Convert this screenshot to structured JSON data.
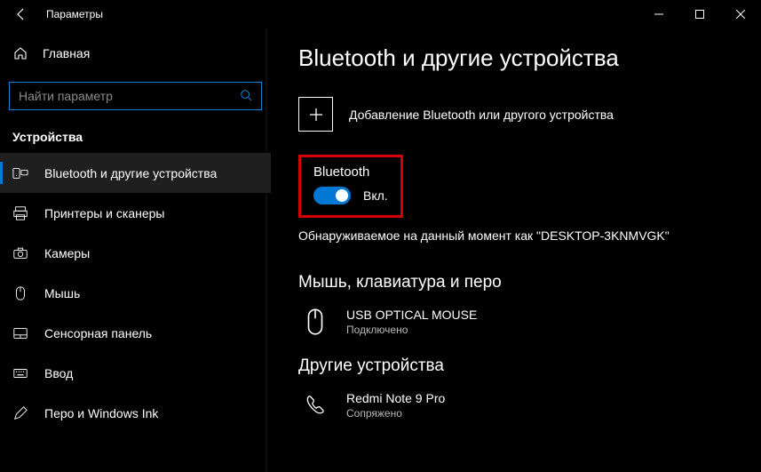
{
  "titlebar": {
    "title": "Параметры"
  },
  "sidebar": {
    "home_label": "Главная",
    "search_placeholder": "Найти параметр",
    "section_label": "Устройства",
    "items": [
      {
        "label": "Bluetooth и другие устройства",
        "icon": "bluetooth-devices-icon",
        "selected": true
      },
      {
        "label": "Принтеры и сканеры",
        "icon": "printer-icon",
        "selected": false
      },
      {
        "label": "Камеры",
        "icon": "camera-icon",
        "selected": false
      },
      {
        "label": "Мышь",
        "icon": "mouse-icon",
        "selected": false
      },
      {
        "label": "Сенсорная панель",
        "icon": "touchpad-icon",
        "selected": false
      },
      {
        "label": "Ввод",
        "icon": "keyboard-icon",
        "selected": false
      },
      {
        "label": "Перо и Windows Ink",
        "icon": "pen-icon",
        "selected": false
      }
    ]
  },
  "main": {
    "heading": "Bluetooth и другие устройства",
    "add_label": "Добавление Bluetooth или другого устройства",
    "bluetooth_label": "Bluetooth",
    "toggle_state": "Вкл.",
    "discoverable": "Обнаруживаемое на данный момент как \"DESKTOP-3KNMVGK\"",
    "section_mouse": "Мышь, клавиатура и перо",
    "device1": {
      "name": "USB OPTICAL MOUSE",
      "status": "Подключено"
    },
    "section_other": "Другие устройства",
    "device2": {
      "name": "Redmi Note 9 Pro",
      "status": "Сопряжено"
    }
  }
}
